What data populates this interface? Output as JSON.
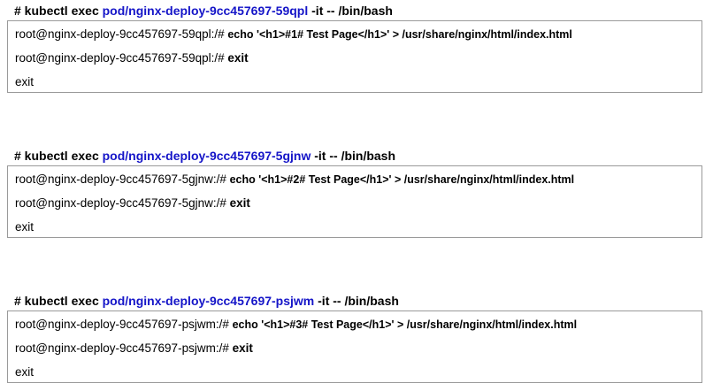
{
  "blocks": [
    {
      "heading": {
        "prefix": "# kubectl exec ",
        "pod": "pod/nginx-deploy-9cc457697-59qpl",
        "suffix": " -it -- /bin/bash"
      },
      "lines": [
        {
          "prompt": "root@nginx-deploy-9cc457697-59qpl:/# ",
          "command": "echo '<h1>#1# Test Page</h1>' > /usr/share/nginx/html/index.html"
        },
        {
          "prompt": "root@nginx-deploy-9cc457697-59qpl:/# ",
          "command": "exit"
        },
        {
          "output": "exit"
        }
      ]
    },
    {
      "heading": {
        "prefix": "# kubectl exec ",
        "pod": "pod/nginx-deploy-9cc457697-5gjnw",
        "suffix": " -it -- /bin/bash"
      },
      "lines": [
        {
          "prompt": "root@nginx-deploy-9cc457697-5gjnw:/# ",
          "command": "echo '<h1>#2# Test Page</h1>' > /usr/share/nginx/html/index.html"
        },
        {
          "prompt": "root@nginx-deploy-9cc457697-5gjnw:/# ",
          "command": "exit"
        },
        {
          "output": "exit"
        }
      ]
    },
    {
      "heading": {
        "prefix": "# kubectl exec ",
        "pod": "pod/nginx-deploy-9cc457697-psjwm",
        "suffix": " -it -- /bin/bash"
      },
      "lines": [
        {
          "prompt": "root@nginx-deploy-9cc457697-psjwm:/# ",
          "command": "echo '<h1>#3# Test Page</h1>' > /usr/share/nginx/html/index.html"
        },
        {
          "prompt": "root@nginx-deploy-9cc457697-psjwm:/# ",
          "command": "exit"
        },
        {
          "output": "exit"
        }
      ]
    }
  ],
  "colors": {
    "pod_link": "#1515c8",
    "box_border": "#9a9a9a",
    "text": "#000000"
  }
}
